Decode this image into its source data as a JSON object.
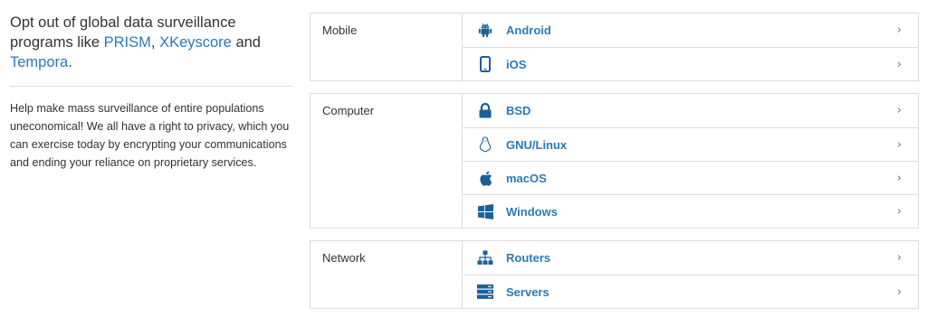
{
  "intro": {
    "headline_before": "Opt out of global data surveillance programs like ",
    "link_prism": "PRISM",
    "sep1": ", ",
    "link_xkeyscore": "XKeyscore",
    "sep2": " and ",
    "link_tempora": "Tempora",
    "end": ".",
    "description": "Help make mass surveillance of entire populations uneconomical! We all have a right to privacy, which you can exercise today by encrypting your communications and ending your reliance on proprietary services."
  },
  "groups": [
    {
      "category": "Mobile",
      "items": [
        {
          "label": "Android",
          "icon": "android-icon",
          "chevron": "›"
        },
        {
          "label": "iOS",
          "icon": "phone-icon",
          "chevron": "›"
        }
      ]
    },
    {
      "category": "Computer",
      "items": [
        {
          "label": "BSD",
          "icon": "lock-icon",
          "chevron": "›"
        },
        {
          "label": "GNU/Linux",
          "icon": "linux-icon",
          "chevron": "›"
        },
        {
          "label": "macOS",
          "icon": "apple-icon",
          "chevron": "›"
        },
        {
          "label": "Windows",
          "icon": "windows-icon",
          "chevron": "›"
        }
      ]
    },
    {
      "category": "Network",
      "items": [
        {
          "label": "Routers",
          "icon": "sitemap-icon",
          "chevron": "›"
        },
        {
          "label": "Servers",
          "icon": "server-icon",
          "chevron": "›"
        }
      ]
    }
  ],
  "colors": {
    "link": "#2a7ab8",
    "icon": "#1c5f99",
    "border": "#dddddd",
    "text": "#333333"
  }
}
